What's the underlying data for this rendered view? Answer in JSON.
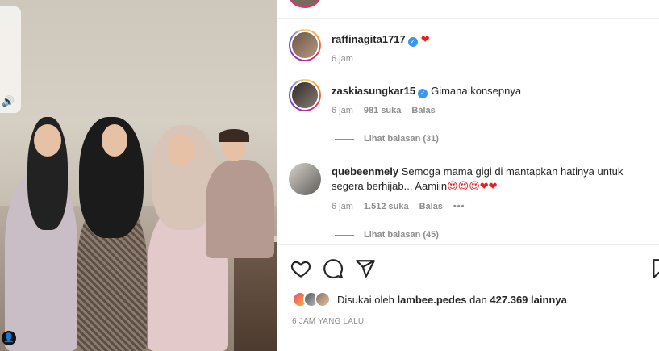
{
  "comments": [
    {
      "username": "raffinagita1717",
      "verified": true,
      "text": "",
      "emoji": "❤",
      "time": "6 jam"
    },
    {
      "username": "zaskiasungkar15",
      "verified": true,
      "text": "Gimana konsepnya",
      "time": "6 jam",
      "likes": "981 suka",
      "reply_label": "Balas",
      "view_replies": "Lihat balasan (31)"
    },
    {
      "username": "quebeenmely",
      "verified": false,
      "text": "Semoga mama gigi di mantapkan hatinya untuk segera berhijab... Aamiin",
      "emoji": "😍😍😍❤❤",
      "time": "6 jam",
      "likes": "1.512 suka",
      "reply_label": "Balas",
      "more": "•••",
      "view_replies": "Lihat balasan (45)"
    }
  ],
  "actions": {
    "icons": [
      "heart-icon",
      "comment-icon",
      "share-icon",
      "bookmark-icon"
    ]
  },
  "likes": {
    "prefix": "Disukai oleh",
    "user": "lambee.pedes",
    "conj": "dan",
    "count": "427.369 lainnya"
  },
  "post_time": "6 JAM YANG LALU",
  "colors": {
    "verified": "#3897f0",
    "heart": "#ed1c24",
    "meta": "#8e8e8e",
    "divider": "#efefef"
  }
}
